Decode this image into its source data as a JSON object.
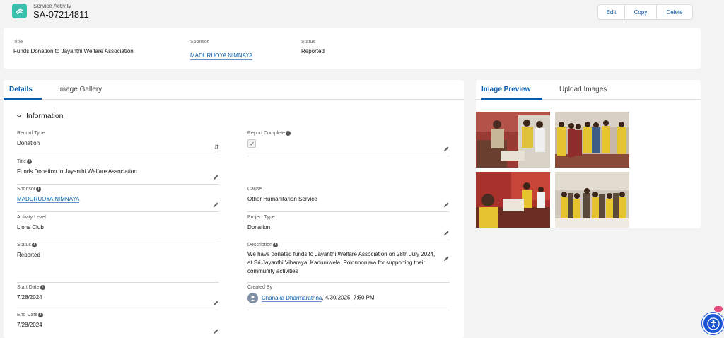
{
  "header": {
    "record_type": "Service Activity",
    "record_name": "SA-07214811",
    "actions": [
      "Edit",
      "Copy",
      "Delete"
    ]
  },
  "highlights": {
    "title_label": "Title",
    "title_value": "Funds Donation to Jayanthi Welfare Association",
    "sponsor_label": "Sponsor",
    "sponsor_value": "MADURUOYA NIMNAYA",
    "status_label": "Status",
    "status_value": "Reported"
  },
  "main_tabs": [
    "Details",
    "Image Gallery"
  ],
  "section_title": "Information",
  "fields": {
    "record_type": {
      "label": "Record Type",
      "value": "Donation"
    },
    "report_complete": {
      "label": "Report Complete"
    },
    "title": {
      "label": "Title",
      "value": "Funds Donation to Jayanthi Welfare Association"
    },
    "sponsor": {
      "label": "Sponsor",
      "value": "MADURUOYA NIMNAYA"
    },
    "cause": {
      "label": "Cause",
      "value": "Other Humanitarian Service"
    },
    "activity_level": {
      "label": "Activity Level",
      "value": "Lions Club"
    },
    "project_type": {
      "label": "Project Type",
      "value": "Donation"
    },
    "status": {
      "label": "Status",
      "value": "Reported"
    },
    "description": {
      "label": "Description",
      "value": "We have donated funds to Jayanthi Welfare Association on 28th July 2024, at Sri Jayanthi Viharaya, Kaduruwela, Polonnoruwa for supporting their community activities"
    },
    "start_date": {
      "label": "Start Date",
      "value": "7/28/2024"
    },
    "created_by": {
      "label": "Created By",
      "user": "Chanaka Dharmarathna",
      "date": ", 4/30/2025, 7:50 PM"
    },
    "end_date": {
      "label": "End Date",
      "value": "7/28/2024"
    }
  },
  "side_tabs": [
    "Image Preview",
    "Upload Images"
  ],
  "images": [
    "event-photo-1",
    "event-photo-2",
    "event-photo-3",
    "event-photo-4"
  ],
  "colors": {
    "brand": "#0b5cab",
    "record_icon": "#3bbfad",
    "accessibility": "#1a55d6"
  }
}
